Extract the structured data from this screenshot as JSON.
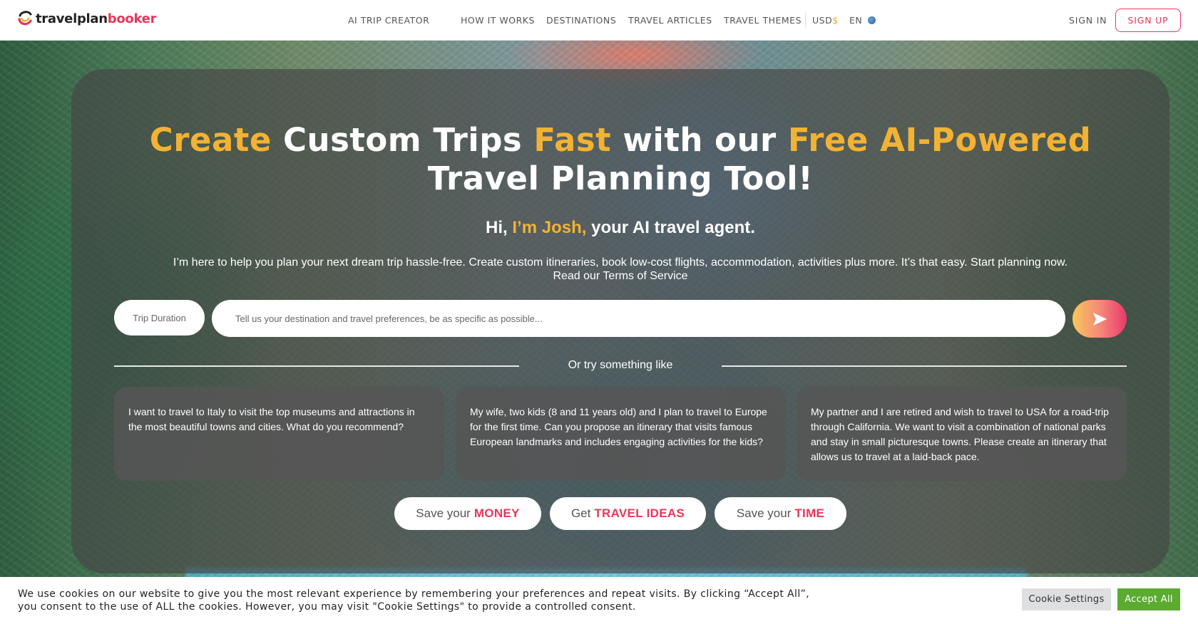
{
  "header": {
    "logo": {
      "part1": "travelplan",
      "part2": "booker"
    },
    "nav": [
      {
        "label": "AI TRIP CREATOR"
      },
      {
        "label": "HOW IT WORKS"
      },
      {
        "label": "DESTINATIONS"
      },
      {
        "label": "TRAVEL ARTICLES"
      },
      {
        "label": "TRAVEL THEMES"
      }
    ],
    "currency": {
      "code": "USD",
      "symbol": "$"
    },
    "language": "EN",
    "language_icon": "globe-icon",
    "sign_in": "SIGN IN",
    "sign_up": "SIGN UP"
  },
  "hero": {
    "headline": {
      "w1": "Create",
      "w2": " Custom Trips ",
      "w3": "Fast",
      "w4": " with our ",
      "w5": "Free AI-Powered",
      "w6": " Travel Planning Tool!"
    },
    "greeting": {
      "hi": "Hi, ",
      "name": "I’m Josh,",
      "rest": " your AI travel agent."
    },
    "description": "I’m here to help you plan your next dream trip hassle-free. Create custom itineraries, book low-cost flights, accommodation, activities plus more. It’s that easy. Start planning now.",
    "terms_link": "Read our Terms of Service",
    "trip_duration": "Trip Duration",
    "input_placeholder": "Tell us your destination and travel preferences, be as specific as possible...",
    "send_icon": "send-arrow-icon",
    "divider_text": "Or try something like",
    "suggestions": [
      "I want to travel to Italy to visit the top museums and attractions in the most beautiful towns and cities. What do you recommend?",
      "My wife, two kids (8 and 11 years old) and I plan to travel to Europe for the first time. Can you propose an itinerary that visits famous European landmarks and includes engaging activities for the kids?",
      "My partner and I are retired and wish to travel to USA for a road-trip through California. We want to visit a combination of national parks and stay in small picturesque towns. Please create an itinerary that allows us to travel at a laid-back pace."
    ],
    "pills": [
      {
        "pre": "Save your",
        "em": "MONEY"
      },
      {
        "pre": "Get",
        "em": "TRAVEL IDEAS"
      },
      {
        "pre": "Save your",
        "em": "TIME"
      }
    ]
  },
  "cookie_bar": {
    "text": "We use cookies on our website to give you the most relevant experience by remembering your preferences and repeat visits. By clicking “Accept All”, you consent to the use of ALL the cookies. However, you may visit \"Cookie Settings\" to provide a controlled consent.",
    "settings_label": "Cookie Settings",
    "accept_label": "Accept All"
  },
  "colors": {
    "accent_pink": "#e8375a",
    "accent_gold": "#f2b233",
    "accept_green": "#5aab30"
  }
}
